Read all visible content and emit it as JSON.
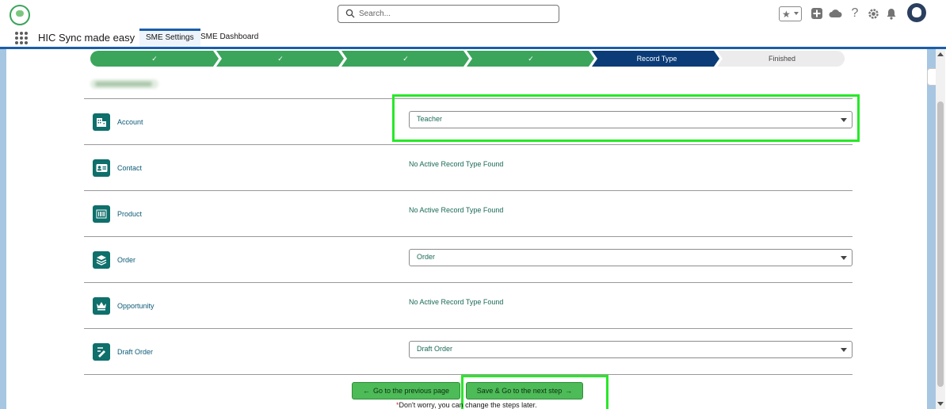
{
  "search": {
    "placeholder": "Search..."
  },
  "header_icons": {
    "favorites": "star-icon",
    "add": "plus-icon",
    "trailhead": "cloud-icon",
    "help": "?",
    "setup": "gear-icon",
    "notifications": "bell-icon"
  },
  "app": {
    "name": "HIC Sync made easy",
    "tabs": [
      "SME Settings",
      "SME Dashboard"
    ],
    "active_tab": "SME Settings"
  },
  "path": {
    "steps": [
      {
        "label": "",
        "state": "complete"
      },
      {
        "label": "",
        "state": "complete"
      },
      {
        "label": "",
        "state": "complete"
      },
      {
        "label": "",
        "state": "complete"
      },
      {
        "label": "Record Type",
        "state": "current"
      },
      {
        "label": "Finished",
        "state": "incomplete"
      }
    ],
    "complete_mark": "✓"
  },
  "rows": [
    {
      "label": "Account",
      "icon": "building-icon",
      "type": "select",
      "value": "Teacher"
    },
    {
      "label": "Contact",
      "icon": "contact-card-icon",
      "type": "text",
      "value": "No Active Record Type Found"
    },
    {
      "label": "Product",
      "icon": "barcode-icon",
      "type": "text",
      "value": "No Active Record Type Found"
    },
    {
      "label": "Order",
      "icon": "layers-icon",
      "type": "select",
      "value": "Order"
    },
    {
      "label": "Opportunity",
      "icon": "crown-icon",
      "type": "text",
      "value": "No Active Record Type Found"
    },
    {
      "label": "Draft Order",
      "icon": "draft-order-icon",
      "type": "select",
      "value": "Draft Order"
    }
  ],
  "buttons": {
    "previous": "Go to the previous page",
    "next": "Save & Go to the next step"
  },
  "note": {
    "asterisk": "*",
    "text": "Don't worry, you can change the steps later."
  },
  "colors": {
    "complete": "#3ba55c",
    "current": "#0b3c78",
    "incomplete": "#ececec",
    "highlight": "#27e827",
    "icon_bg": "#0e6f6b"
  }
}
